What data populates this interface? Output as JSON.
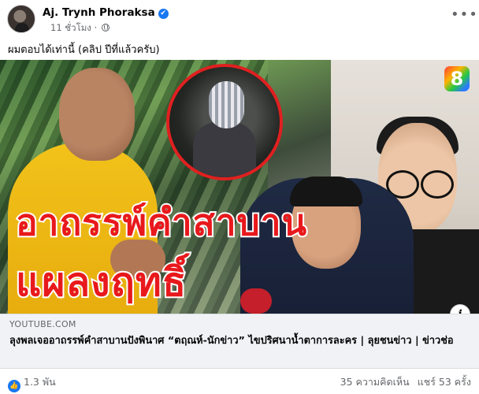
{
  "post": {
    "author": "Aj. Trynh Phoraksa",
    "verified_icon": "✔",
    "time": "11 ชั่วโมง",
    "privacy_icon": "globe-icon",
    "more_icon": "•••",
    "caption": "ผมตอบได้เท่านี้ (คลิป ปีที่แล้วครับ)"
  },
  "media": {
    "headline_line1": "อาถรรพ์คำสาบาน",
    "headline_line2": "แผลงฤทธิ์",
    "channel_logo": "8",
    "info_icon": "i"
  },
  "link": {
    "domain": "YOUTUBE.COM",
    "title": "ลุงพลเจออาถรรพ์คำสาบานปังพินาศ “ตฤณห์-นักข่าว” ไขปริศนาน้ำตาการละคร | ลุยชนข่าว | ข่าวช่อ"
  },
  "footer": {
    "like_icon": "👍",
    "reactions_count": "1.3 พัน",
    "comments": "35 ความคิดเห็น",
    "shares": "แชร์ 53 ครั้ง"
  },
  "colors": {
    "accent_blue": "#1877f2",
    "headline_red": "#e8191c",
    "link_box_bg": "#f0f2f5"
  }
}
